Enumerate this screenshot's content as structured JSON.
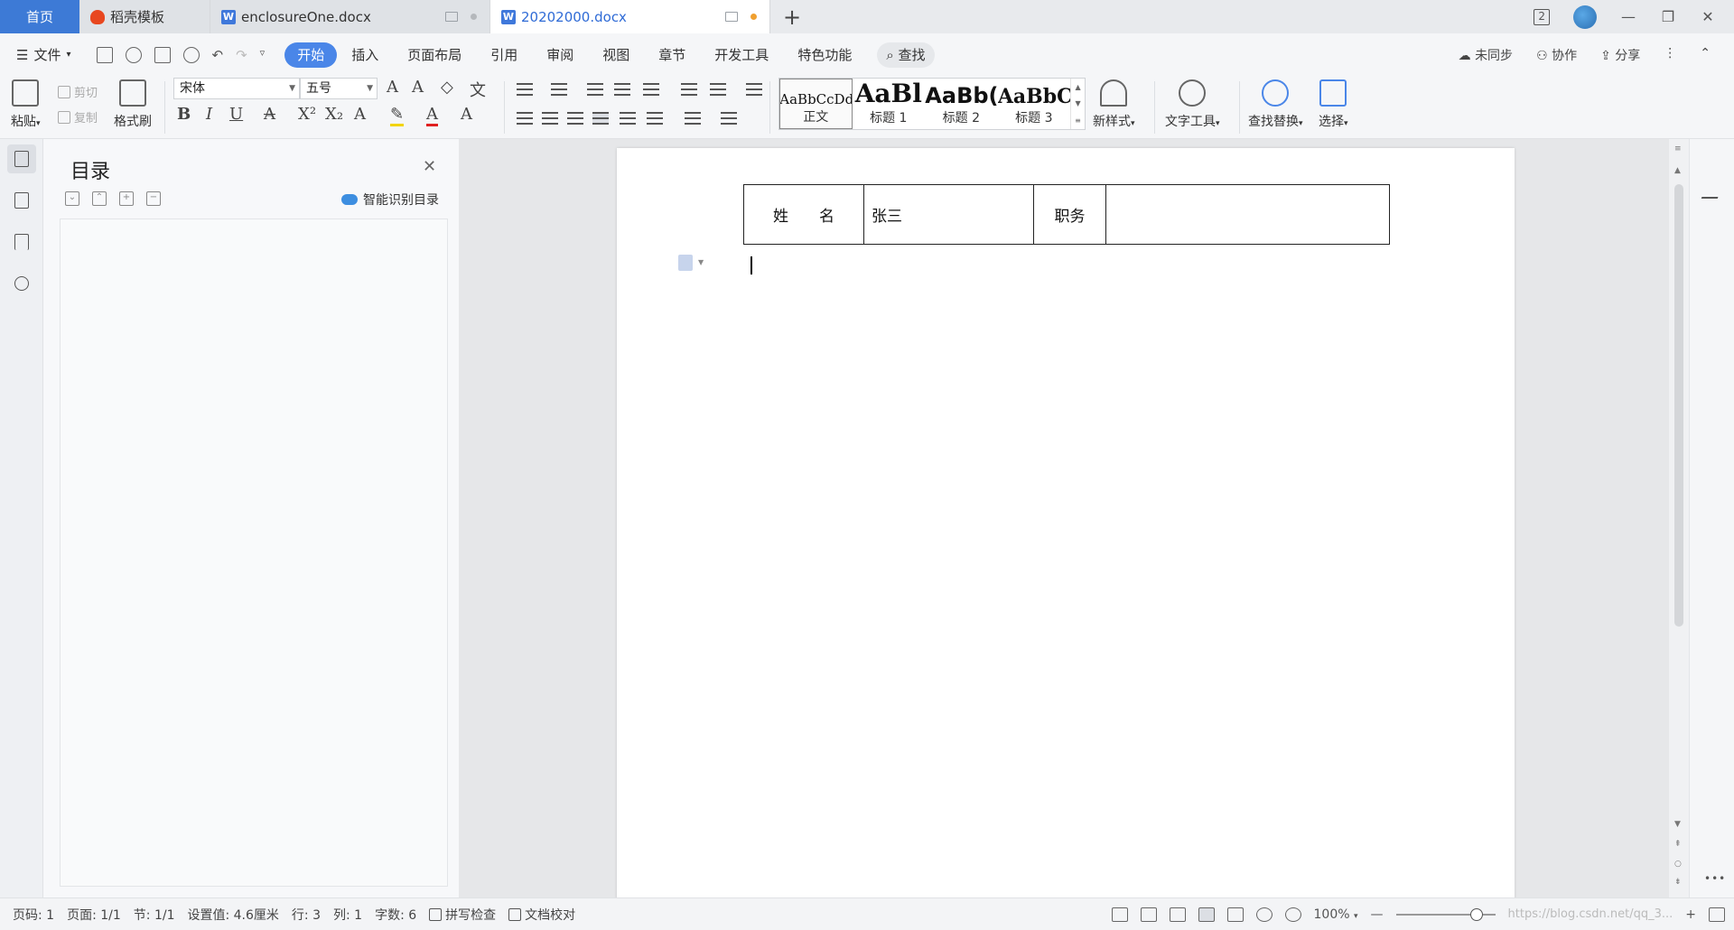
{
  "tabs": {
    "home": "首页",
    "items": [
      {
        "label": "稻壳模板"
      },
      {
        "label": "enclosureOne.docx"
      },
      {
        "label": "20202000.docx"
      }
    ],
    "new_tab": "+"
  },
  "window": {
    "badge": "2",
    "minimize": "—",
    "restore": "❐",
    "close": "✕"
  },
  "menubar": {
    "file": "文件",
    "items": [
      "开始",
      "插入",
      "页面布局",
      "引用",
      "审阅",
      "视图",
      "章节",
      "开发工具",
      "特色功能"
    ],
    "active": "开始",
    "search": "查找",
    "right": [
      "未同步",
      "协作",
      "分享"
    ]
  },
  "ribbon": {
    "paste": "粘贴",
    "cut": "剪切",
    "copy": "复制",
    "format_painter": "格式刷",
    "font_name": "宋体",
    "font_size": "五号",
    "styles": [
      {
        "preview": "AaBbCcDd",
        "label": "正文"
      },
      {
        "preview": "AaBl",
        "label": "标题 1"
      },
      {
        "preview": "AaBb(",
        "label": "标题 2"
      },
      {
        "preview": "AaBbC",
        "label": "标题 3"
      }
    ],
    "new_style": "新样式",
    "text_tools": "文字工具",
    "find_replace": "查找替换",
    "select": "选择"
  },
  "toc": {
    "title": "目录",
    "smart": "智能识别目录"
  },
  "document": {
    "table": [
      [
        "姓　　名",
        "张三",
        "职务",
        ""
      ]
    ]
  },
  "statusbar": {
    "page_num": "页码: 1",
    "page": "页面: 1/1",
    "section": "节: 1/1",
    "setting": "设置值: 4.6厘米",
    "row": "行: 3",
    "col": "列: 1",
    "words": "字数: 6",
    "spell": "拼写检查",
    "proof": "文档校对",
    "zoom": "100%",
    "watermark": "https://blog.csdn.net/qq_3..."
  },
  "colors": {
    "accent": "#4a86e8",
    "home_tab": "#3d7ad6"
  }
}
